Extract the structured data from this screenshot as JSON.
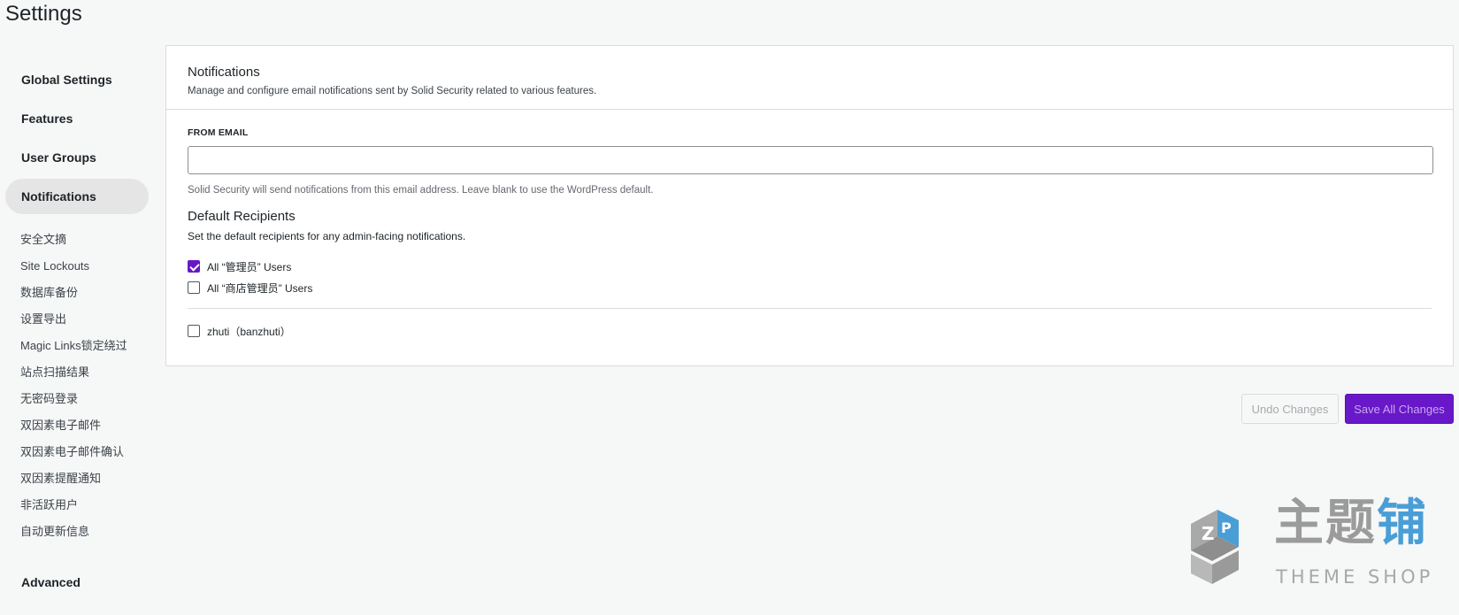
{
  "page": {
    "title": "Settings"
  },
  "sidebar": {
    "top_items": [
      {
        "label": "Global Settings"
      },
      {
        "label": "Features"
      },
      {
        "label": "User Groups"
      },
      {
        "label": "Notifications",
        "active": true
      }
    ],
    "sub_items": [
      {
        "label": "安全文摘"
      },
      {
        "label": "Site Lockouts"
      },
      {
        "label": "数据库备份"
      },
      {
        "label": "设置导出"
      },
      {
        "label": "Magic Links锁定绕过"
      },
      {
        "label": "站点扫描结果"
      },
      {
        "label": "无密码登录"
      },
      {
        "label": "双因素电子邮件"
      },
      {
        "label": "双因素电子邮件确认"
      },
      {
        "label": "双因素提醒通知"
      },
      {
        "label": "非活跃用户"
      },
      {
        "label": "自动更新信息"
      }
    ],
    "bottom_item": {
      "label": "Advanced"
    }
  },
  "card": {
    "title": "Notifications",
    "description": "Manage and configure email notifications sent by Solid Security related to various features.",
    "from_email": {
      "label": "FROM EMAIL",
      "value": "",
      "help": "Solid Security will send notifications from this email address. Leave blank to use the WordPress default."
    },
    "recipients": {
      "title": "Default Recipients",
      "description": "Set the default recipients for any admin-facing notifications.",
      "roles": [
        {
          "label": "All “管理员” Users",
          "checked": true
        },
        {
          "label": "All “商店管理员” Users",
          "checked": false
        }
      ],
      "users": [
        {
          "label": "zhuti（banzhuti）",
          "checked": false
        }
      ]
    }
  },
  "actions": {
    "undo_label": "Undo Changes",
    "save_label": "Save All Changes"
  },
  "watermark": {
    "chinese_gray": "主题",
    "chinese_blue": "铺",
    "english": "THEME SHOP"
  },
  "colors": {
    "accent": "#6818c8",
    "watermark_blue": "#4a9ed6"
  }
}
